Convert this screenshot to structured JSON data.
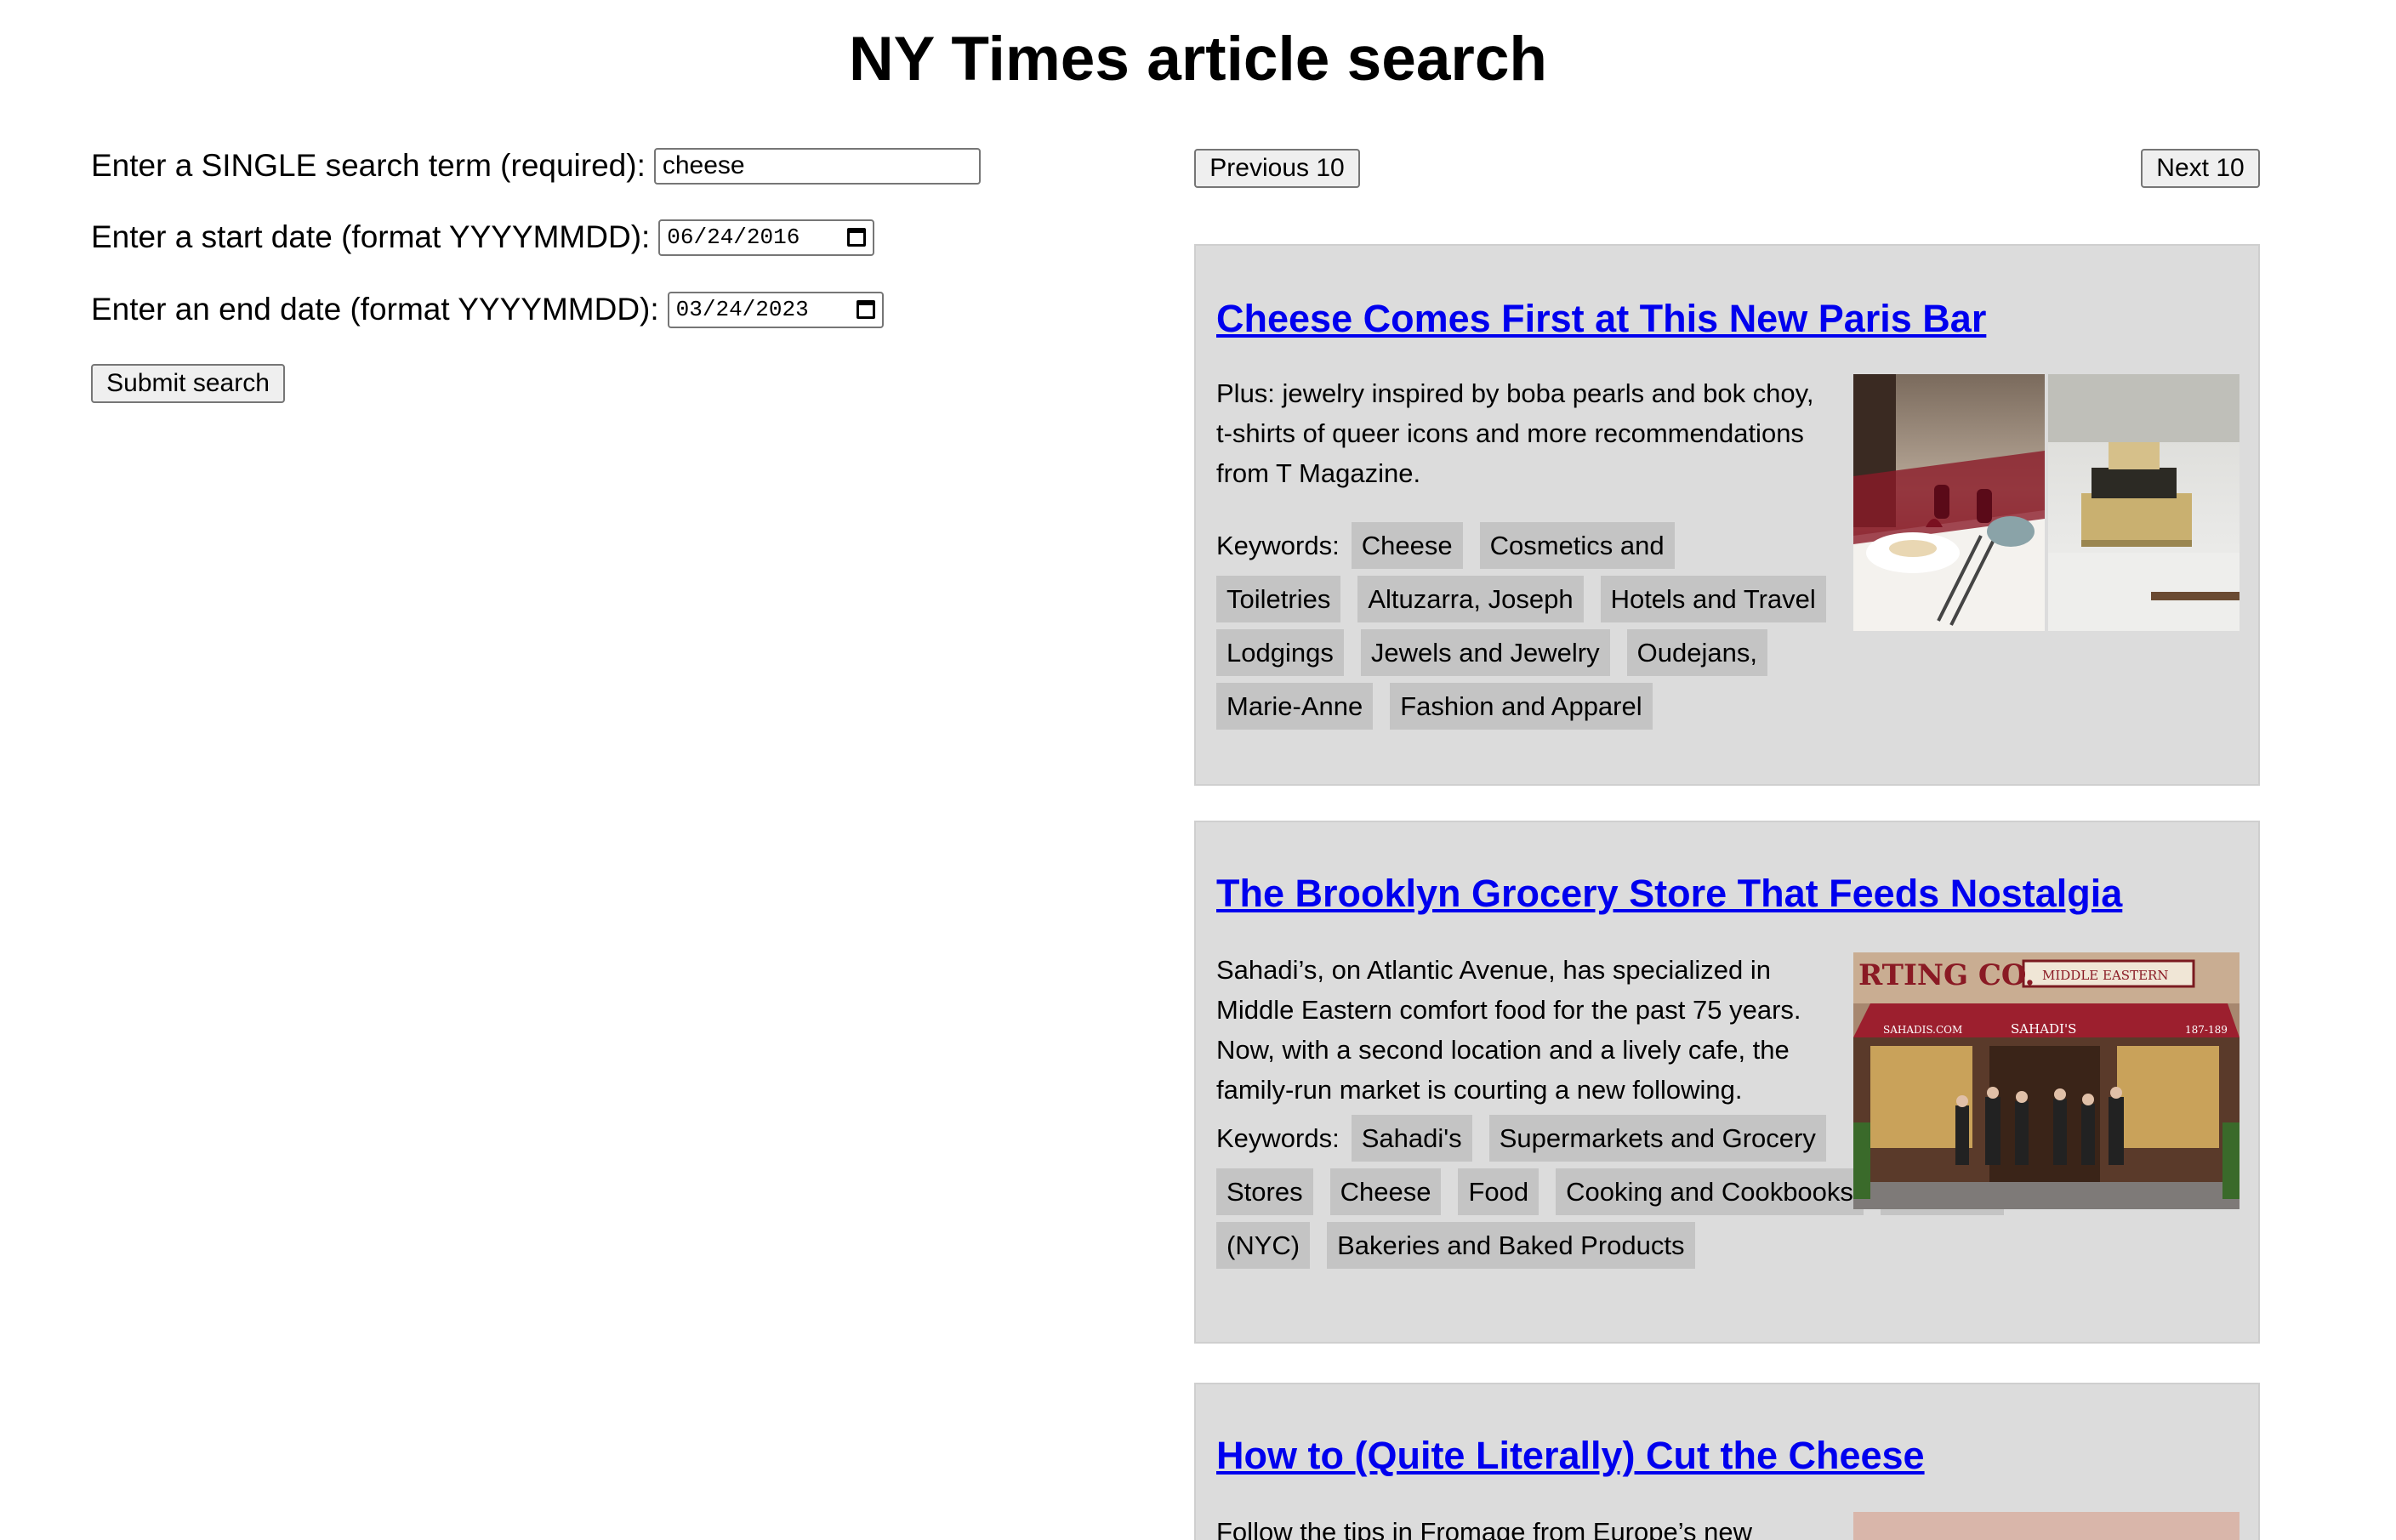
{
  "header": {
    "title": "NY Times article search"
  },
  "form": {
    "search_label": "Enter a SINGLE search term (required):",
    "search_value": "cheese",
    "start_label": "Enter a start date (format YYYYMMDD):",
    "start_value": "06/24/2016",
    "end_label": "Enter an end date (format YYYYMMDD):",
    "end_value": "03/24/2023",
    "submit_label": "Submit search"
  },
  "pager": {
    "prev_label": "Previous 10",
    "next_label": "Next 10"
  },
  "keywords_label": "Keywords:",
  "articles": [
    {
      "title": "Cheese Comes First at This New Paris Bar",
      "abstract": "Plus: jewelry inspired by boba pearls and bok choy, t-shirts of queer icons and more recommendations from T Magazine.",
      "keywords": [
        "Cheese",
        "Cosmetics and Toiletries",
        "Altuzarra, Joseph",
        "Hotels and Travel Lodgings",
        "Jewels and Jewelry",
        "Oudejans, Marie-Anne",
        "Fashion and Apparel"
      ]
    },
    {
      "title": "The Brooklyn Grocery Store That Feeds Nostalgia",
      "abstract": "Sahadi’s, on Atlantic Avenue, has specialized in Middle Eastern comfort food for the past 75 years. Now, with a second location and a lively cafe, the family-run market is courting a new following.",
      "keywords": [
        "Sahadi's",
        "Supermarkets and Grocery Stores",
        "Cheese",
        "Food",
        "Cooking and Cookbooks",
        "Brooklyn (NYC)",
        "Bakeries and Baked Products"
      ],
      "image_sign": "RTING CO.",
      "image_sign_sub": "MIDDLE EASTERN",
      "image_awning": "SAHADI'S",
      "image_awning_left": "SAHADIS.COM",
      "image_awning_right": "187-189"
    },
    {
      "title": "How to (Quite Literally) Cut the Cheese",
      "abstract": "Follow the tips in Fromage from Europe’s new"
    }
  ]
}
